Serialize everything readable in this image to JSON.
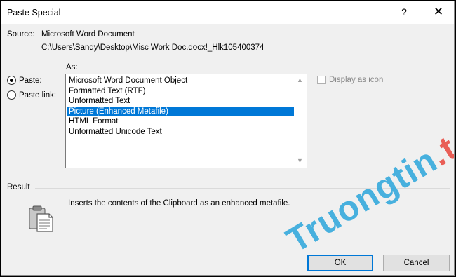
{
  "dialog": {
    "title": "Paste Special",
    "help_glyph": "?",
    "close_glyph": "✕"
  },
  "source": {
    "label": "Source:",
    "app": "Microsoft Word Document",
    "path": "C:\\Users\\Sandy\\Desktop\\Misc Work Doc.docx!_Hlk105400374"
  },
  "options": {
    "as_label": "As:",
    "paste_label": "Paste:",
    "paste_link_label": "Paste link:",
    "selected_mode": "Paste"
  },
  "formats": [
    "Microsoft Word Document Object",
    "Formatted Text (RTF)",
    "Unformatted Text",
    "Picture (Enhanced Metafile)",
    "HTML Format",
    "Unformatted Unicode Text"
  ],
  "selected_format": "Picture (Enhanced Metafile)",
  "display_as_icon": {
    "label": "Display as icon",
    "checked": false,
    "enabled": false
  },
  "result": {
    "label": "Result",
    "text": "Inserts the contents of the Clipboard as an enhanced metafile.",
    "icon": "clipboard-icon"
  },
  "buttons": {
    "ok": "OK",
    "cancel": "Cancel"
  },
  "watermark": {
    "part1": "Truongtin",
    "part2": ".top"
  },
  "colors": {
    "selection": "#0078d7",
    "dialog_bg": "#f0f0f0",
    "watermark_blue": "#2aa6dc",
    "watermark_red": "#e8453c"
  }
}
